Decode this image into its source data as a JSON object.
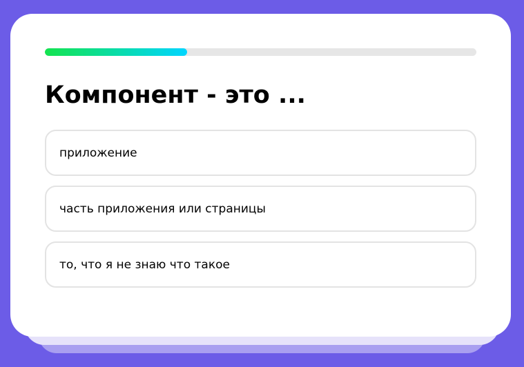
{
  "quiz": {
    "progress": 0.33,
    "question": "Компонент - это ...",
    "answers": [
      {
        "label": "приложение"
      },
      {
        "label": "часть приложения или страницы"
      },
      {
        "label": "то, что я не знаю что такое"
      }
    ]
  },
  "colors": {
    "background": "#6c5ce7",
    "card": "#ffffff",
    "progress_start": "#14e34f",
    "progress_end": "#00d5ff",
    "progress_track": "#e6e6e6",
    "option_border": "#e3e3e3"
  }
}
